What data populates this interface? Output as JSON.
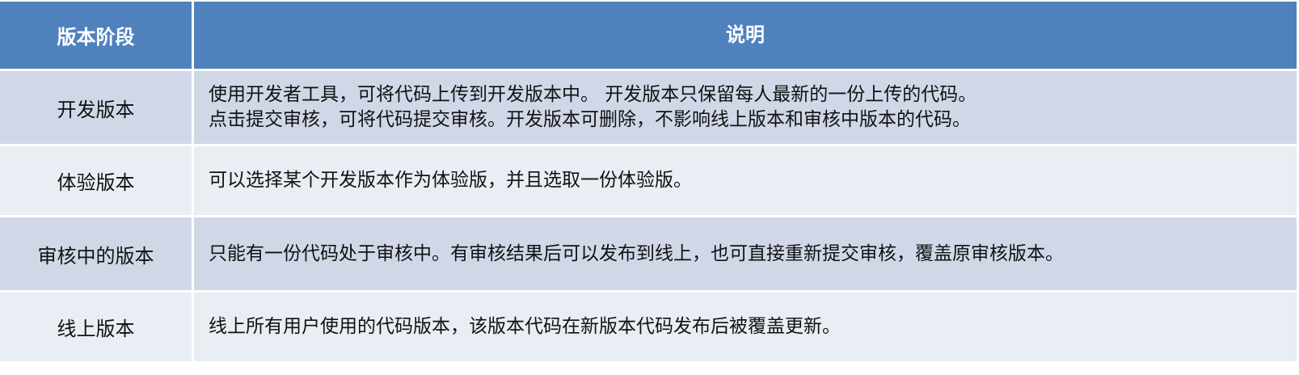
{
  "header": {
    "stage": "版本阶段",
    "description": "说明"
  },
  "rows": [
    {
      "stage": "开发版本",
      "lines": [
        "使用开发者工具，可将代码上传到开发版本中。 开发版本只保留每人最新的一份上传的代码。",
        "点击提交审核，可将代码提交审核。开发版本可删除，不影响线上版本和审核中版本的代码。"
      ]
    },
    {
      "stage": "体验版本",
      "lines": [
        "可以选择某个开发版本作为体验版，并且选取一份体验版。"
      ]
    },
    {
      "stage": "审核中的版本",
      "lines": [
        "只能有一份代码处于审核中。有审核结果后可以发布到线上，也可直接重新提交审核，覆盖原审核版本。"
      ]
    },
    {
      "stage": "线上版本",
      "lines": [
        "线上所有用户使用的代码版本，该版本代码在新版本代码发布后被覆盖更新。"
      ]
    }
  ],
  "colors": {
    "header_bg": "#4f81bd",
    "row_odd_bg": "#d0d8e8",
    "row_even_bg": "#e9edf4"
  }
}
